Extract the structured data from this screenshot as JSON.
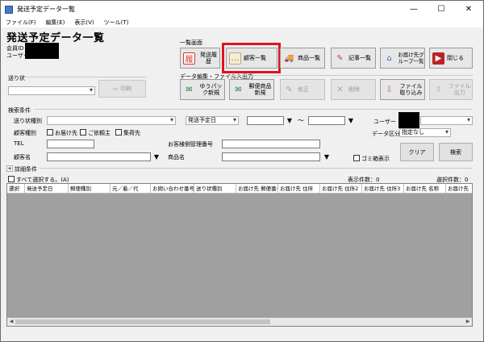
{
  "window": {
    "title": "発送予定データ一覧",
    "minimize": "—",
    "maximize": "☐",
    "close": "✕"
  },
  "menu": [
    "ファイル(F)",
    "編集(E)",
    "表示(V)",
    "ツール(T)"
  ],
  "heading": "発送予定データ一覧",
  "member_label": "会員ID",
  "user_label": "ユーザー",
  "list_screen_label": "一覧画面",
  "data_edit_label": "データ編集・ファイル入出力",
  "delivery_status_label": "送り状",
  "delivery_status_btn": "印刷",
  "toolbar_top": [
    {
      "label": "発送履歴",
      "icon": "履",
      "color": "#d9342b"
    },
    {
      "label": "顧客一覧",
      "icon": "…",
      "color": "#bfa77a"
    },
    {
      "label": "商品一覧",
      "icon": "🚚",
      "color": "#5b7fbf"
    },
    {
      "label": "記事一覧",
      "icon": "✎",
      "color": "#c03a8a"
    },
    {
      "label": "お届け先グループ一覧",
      "icon": "⌂",
      "color": "#3f6fc2"
    },
    {
      "label": "閉じる",
      "icon": "▶",
      "color": "#b8232a"
    }
  ],
  "toolbar_bottom": [
    {
      "label": "ゆうパック新規",
      "icon": "✉",
      "color": "#2b7a3c"
    },
    {
      "label": "郵便商品新規",
      "icon": "✉",
      "color": "#2b7a3c"
    },
    {
      "label": "修正",
      "icon": "✎",
      "color": "#aaaaaa"
    },
    {
      "label": "削除",
      "icon": "✕",
      "color": "#aaaaaa"
    },
    {
      "label": "ファイル取り込み",
      "icon": "⇩",
      "color": "#c0559a"
    },
    {
      "label": "ファイル出力",
      "icon": "⇧",
      "color": "#aaaaaa"
    }
  ],
  "search": {
    "section_label": "検索条件",
    "slip_type_label": "送り状種別",
    "date_select": "発送予定日",
    "tilde": "〜",
    "user_label": "ユーザー",
    "customer_type_label": "顧客種別",
    "checkbox_recipient": "お届け先",
    "checkbox_client": "ご依頼主",
    "checkbox_shipper": "集荷先",
    "data_class_label": "データ区分",
    "data_class_value": "指定なし",
    "tel_label": "TEL",
    "mgmt_no_label": "お客様側管理番号",
    "customer_name_label": "顧客名",
    "product_name_label": "商品名",
    "trash_label": "ゴミ箱表示",
    "clear_btn": "クリア",
    "search_btn": "検索",
    "detail_label": "詳細条件",
    "detail_toggle": "+"
  },
  "list": {
    "select_all": "すべて選択する。(A)",
    "display_count": "表示件数：0",
    "selected_count": "選択件数：0",
    "columns": [
      "選択",
      "発送予定日",
      "郵便種別",
      "元／着／代",
      "お問い合わせ番号",
      "送り状種別",
      "お届け先 郵便番号",
      "お届け先 住所",
      "お届け先 住所2",
      "お届け先 住所3",
      "お届け先 名称",
      "お届け先"
    ]
  }
}
